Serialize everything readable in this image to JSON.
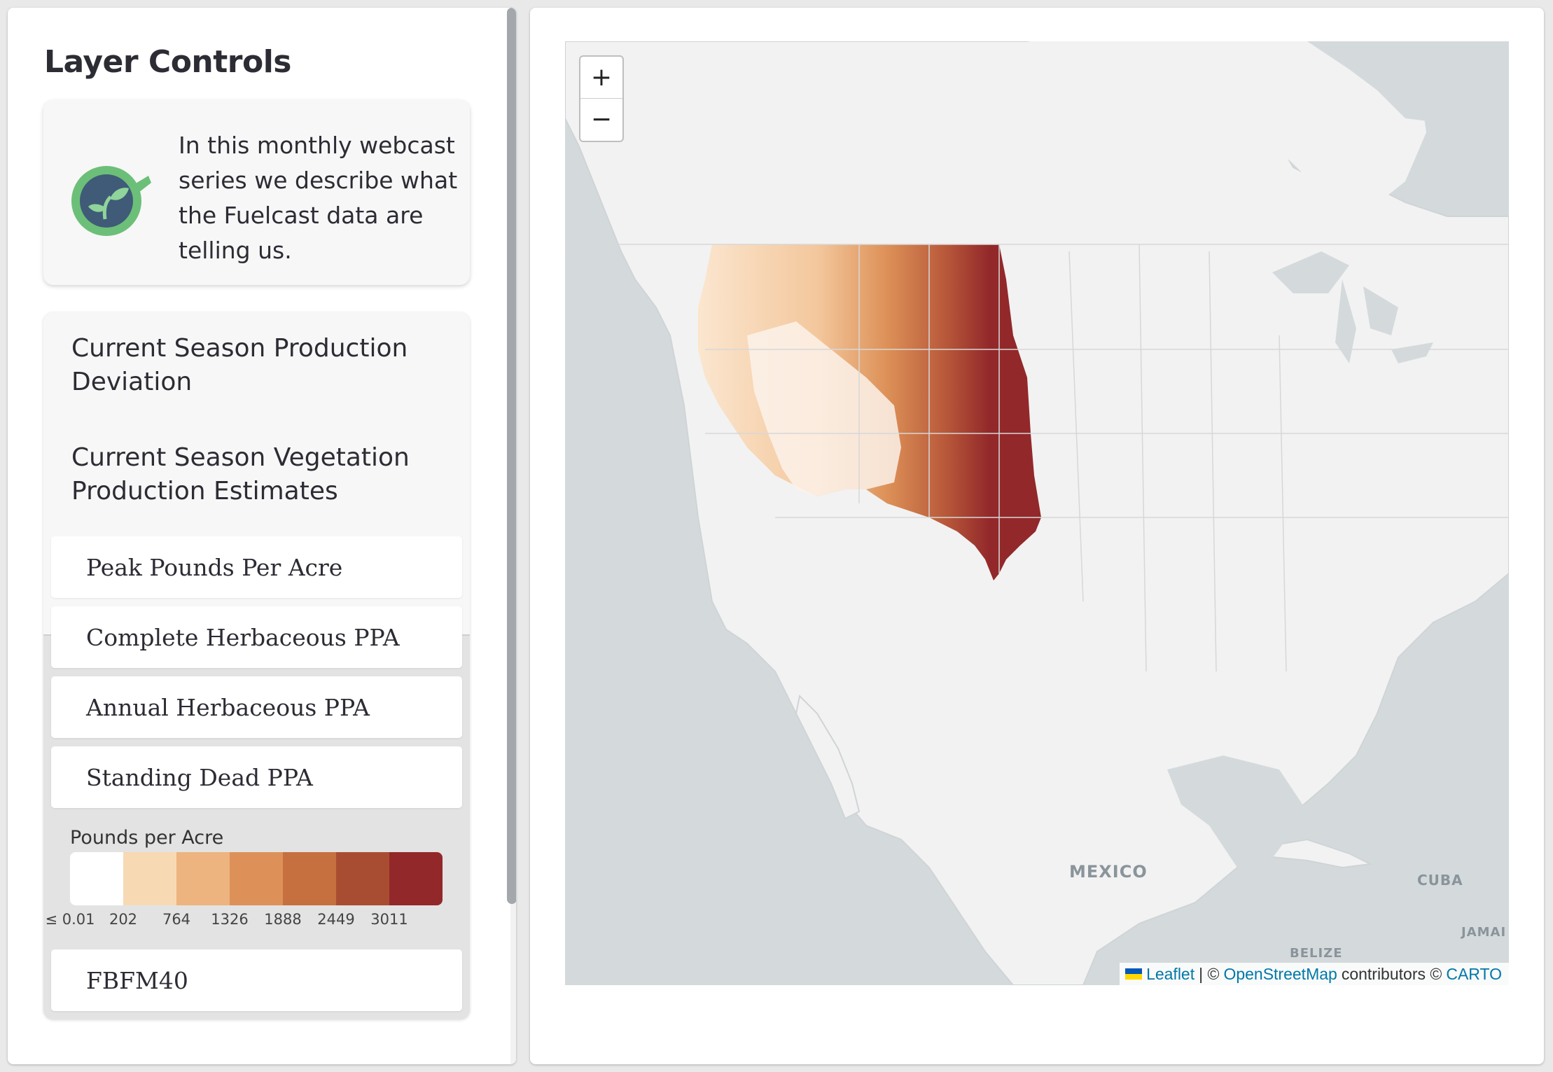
{
  "sidebar": {
    "title": "Layer Controls",
    "info_card": {
      "text": "In this monthly webcast series we describe what the Fuelcast data are telling us.",
      "icon": "webcast-mug-leaf-icon"
    },
    "sections": [
      {
        "label": "Current Season Production Deviation"
      },
      {
        "label": "Current Season Vegetation Production Estimates"
      }
    ],
    "layers": [
      {
        "label": "Peak Pounds Per Acre"
      },
      {
        "label": "Complete Herbaceous PPA"
      },
      {
        "label": "Annual Herbaceous PPA"
      },
      {
        "label": "Standing Dead PPA"
      }
    ],
    "legend": {
      "title": "Pounds per Acre",
      "labels": [
        "≤ 0.01",
        "202",
        "764",
        "1326",
        "1888",
        "2449",
        "3011"
      ],
      "colors": [
        "#ffffff",
        "#f7d9b4",
        "#edb47f",
        "#dd9158",
        "#c67040",
        "#a94d32",
        "#92282a"
      ]
    },
    "extra_layer": {
      "label": "FBFM40"
    }
  },
  "map": {
    "zoom_in": "+",
    "zoom_out": "−",
    "labels": {
      "mexico": "MEXICO",
      "cuba": "CUBA",
      "belize": "BELIZE",
      "jamaica": "JAMAI"
    },
    "attribution": {
      "leaflet": "Leaflet",
      "sep": "| ©",
      "osm": "OpenStreetMap",
      "contributors": "contributors ©",
      "carto": "CARTO"
    }
  }
}
